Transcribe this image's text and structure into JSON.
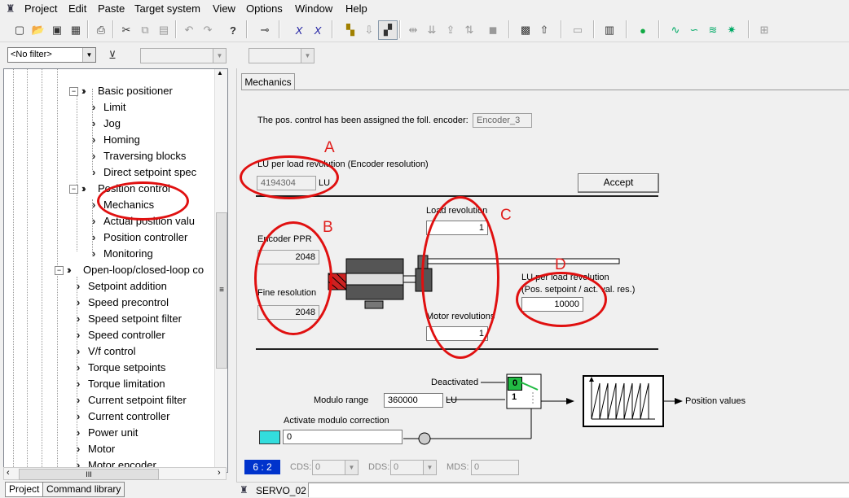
{
  "menu": [
    "Project",
    "Edit",
    "Paste",
    "Target system",
    "View",
    "Options",
    "Window",
    "Help"
  ],
  "toolbar2": {
    "filter_value": "<No filter>"
  },
  "tree": {
    "items": [
      {
        "label": "Basic positioner",
        "type": "folder"
      },
      {
        "label": "Limit",
        "type": "leaf"
      },
      {
        "label": "Jog",
        "type": "leaf"
      },
      {
        "label": "Homing",
        "type": "leaf"
      },
      {
        "label": "Traversing blocks",
        "type": "leaf"
      },
      {
        "label": "Direct setpoint spec",
        "type": "leaf"
      },
      {
        "label": "Position control",
        "type": "folder"
      },
      {
        "label": "Mechanics",
        "type": "leaf"
      },
      {
        "label": "Actual position valu",
        "type": "leaf"
      },
      {
        "label": "Position controller",
        "type": "leaf"
      },
      {
        "label": "Monitoring",
        "type": "leaf"
      },
      {
        "label": "Open-loop/closed-loop co",
        "type": "folder"
      },
      {
        "label": "Setpoint addition",
        "type": "leaf"
      },
      {
        "label": "Speed precontrol",
        "type": "leaf"
      },
      {
        "label": "Speed setpoint filter",
        "type": "leaf"
      },
      {
        "label": "Speed controller",
        "type": "leaf"
      },
      {
        "label": "V/f control",
        "type": "leaf"
      },
      {
        "label": "Torque setpoints",
        "type": "leaf"
      },
      {
        "label": "Torque limitation",
        "type": "leaf"
      },
      {
        "label": "Current setpoint filter",
        "type": "leaf"
      },
      {
        "label": "Current controller",
        "type": "leaf"
      },
      {
        "label": "Power unit",
        "type": "leaf"
      },
      {
        "label": "Motor",
        "type": "leaf"
      },
      {
        "label": "Motor encoder",
        "type": "leaf"
      }
    ],
    "scroll_left": "‹",
    "scroll_thumb": "III",
    "scroll_right": "›",
    "vscroll_thumb": "≡"
  },
  "bottom_tabs": [
    "Project",
    "Command library"
  ],
  "main": {
    "tab": "Mechanics",
    "encoder_text": "The pos. control has been assigned the foll. encoder:",
    "encoder_value": "Encoder_3",
    "lu_label": "LU per load revolution (Encoder resolution)",
    "lu_value": "4194304",
    "lu_unit": "LU",
    "accept": "Accept",
    "encoder_ppr_label": "Encoder PPR",
    "encoder_ppr_value": "2048",
    "fine_res_label": "Fine resolution",
    "fine_res_value": "2048",
    "load_rev_label": "Load revolution",
    "load_rev_value": "1",
    "motor_rev_label": "Motor revolutions",
    "motor_rev_value": "1",
    "lu_per_load_label": "LU per load revolution",
    "lu_per_load_sub": "(Pos. setpoint / act. val. res.)",
    "lu_per_load_value": "10000",
    "deactivated": "Deactivated",
    "switch_0": "0",
    "switch_1": "1",
    "modulo_label": "Modulo range",
    "modulo_value": "360000",
    "modulo_unit": "LU",
    "activate_label": "Activate modulo correction",
    "activate_value": "0",
    "position_values": "Position values"
  },
  "annotations": {
    "A": "A",
    "B": "B",
    "C": "C",
    "D": "D"
  },
  "status": {
    "index": "6 : 2",
    "cds_label": "CDS:",
    "cds_value": "0",
    "dds_label": "DDS:",
    "dds_value": "0",
    "mds_label": "MDS:",
    "mds_value": "0"
  },
  "bottom": {
    "device": "SERVO_02"
  },
  "colors": {
    "accent_blue": "#0000cc",
    "annotation_red": "#e01010",
    "switch_green": "#22bb44",
    "cyan": "#33dddd"
  }
}
